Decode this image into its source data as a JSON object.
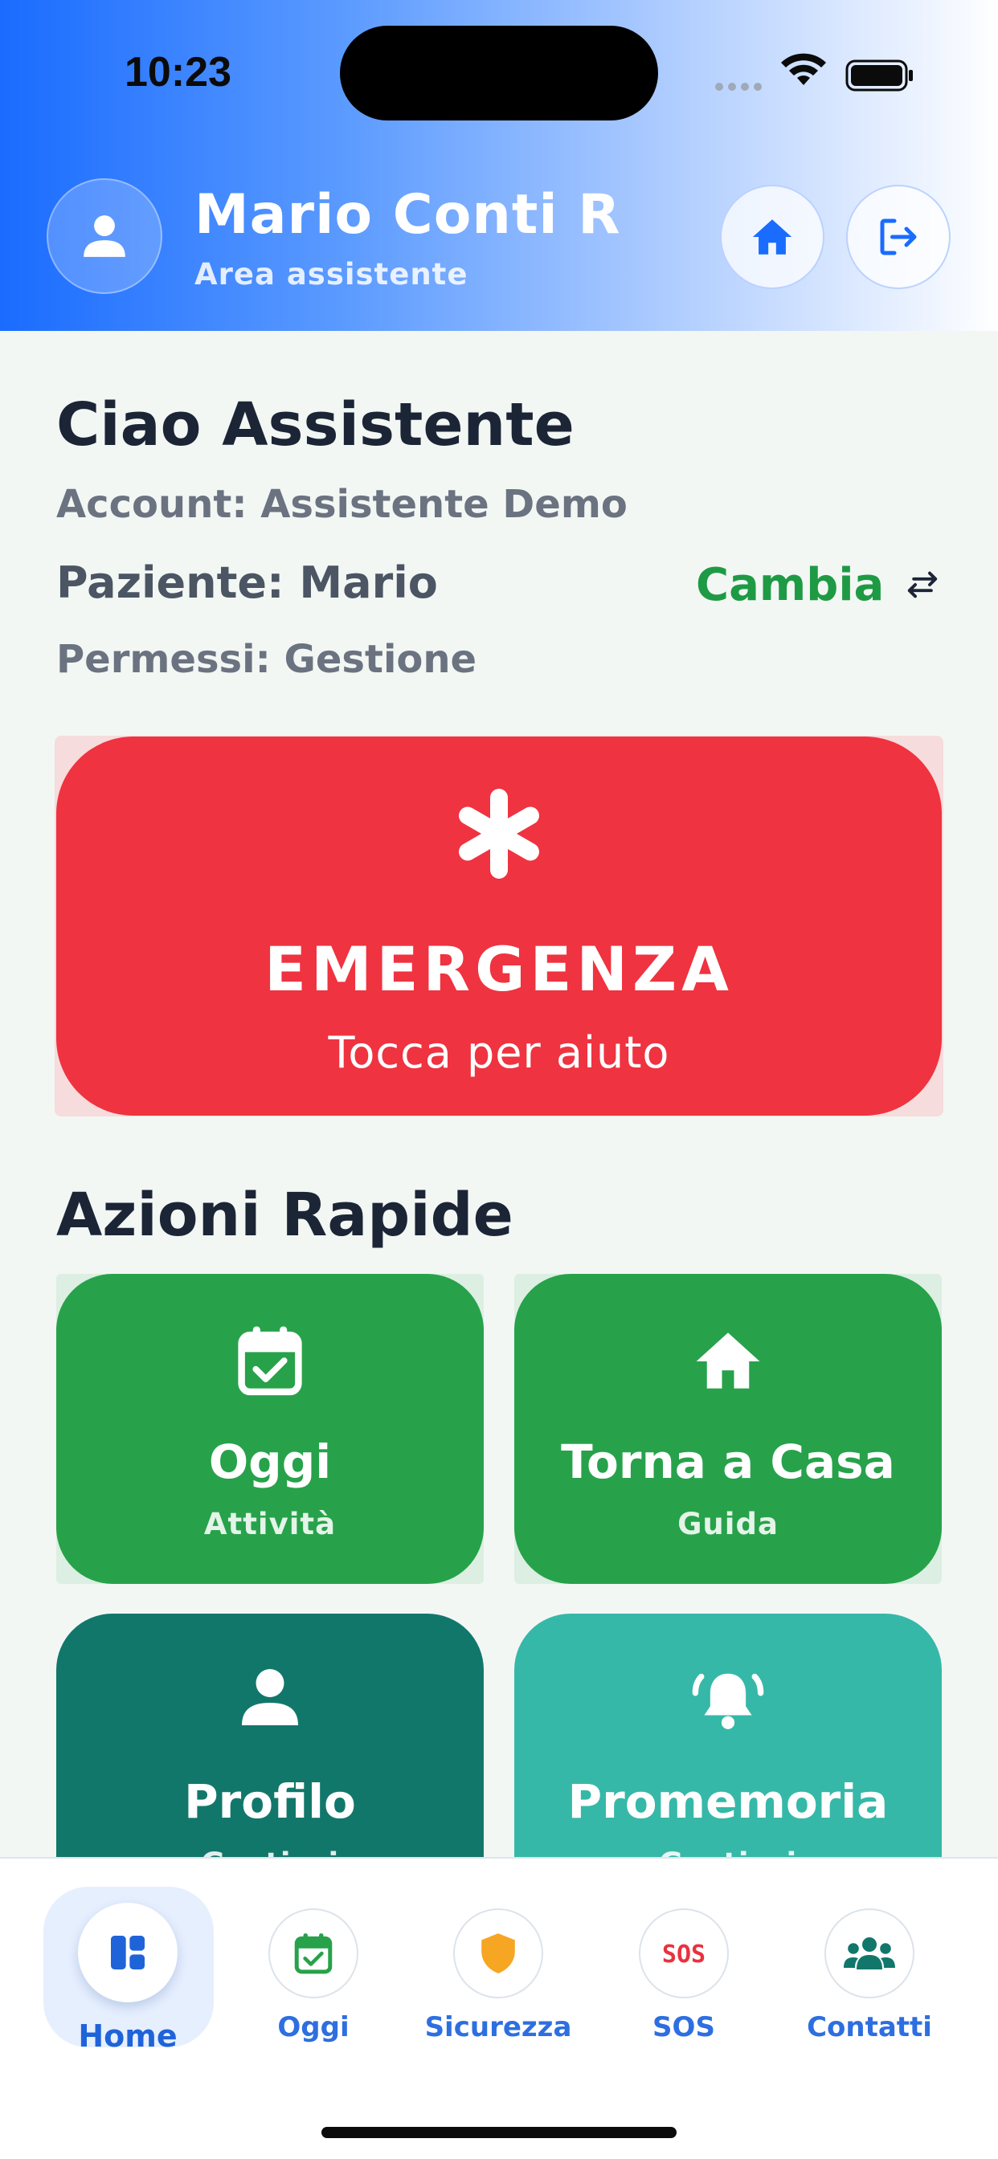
{
  "status_bar": {
    "time": "10:23"
  },
  "header": {
    "user_name": "Mario Conti R",
    "user_role": "Area assistente",
    "home_icon": "home-icon",
    "logout_icon": "logout-icon"
  },
  "greeting": {
    "title": "Ciao Assistente",
    "account": "Account: Assistente Demo",
    "patient": "Paziente: Mario",
    "change_label": "Cambia",
    "permissions": "Permessi: Gestione"
  },
  "emergency": {
    "icon": "asterisk-icon",
    "title": "EMERGENZA",
    "subtitle": "Tocca per aiuto",
    "color": "#ef3340"
  },
  "quick_actions": {
    "title": "Azioni Rapide",
    "tiles": [
      {
        "title": "Oggi",
        "subtitle": "Attività",
        "icon": "calendar-check-icon",
        "color": "#27a24a"
      },
      {
        "title": "Torna a Casa",
        "subtitle": "Guida",
        "icon": "home-icon",
        "color": "#27a24a"
      },
      {
        "title": "Profilo",
        "subtitle": "Gestisci",
        "icon": "user-icon",
        "color": "#12776b"
      },
      {
        "title": "Promemoria",
        "subtitle": "Gestisci",
        "icon": "bell-ring-icon",
        "color": "#36b8a8"
      }
    ]
  },
  "bottom_nav": {
    "items": [
      {
        "label": "Home",
        "icon": "dashboard-icon",
        "active": true
      },
      {
        "label": "Oggi",
        "icon": "calendar-check-icon",
        "active": false
      },
      {
        "label": "Sicurezza",
        "icon": "shield-icon",
        "active": false
      },
      {
        "label": "SOS",
        "icon": "sos-icon",
        "active": false
      },
      {
        "label": "Contatti",
        "icon": "contacts-icon",
        "active": false
      }
    ]
  },
  "colors": {
    "primary": "#1a6cff",
    "success": "#27a24a",
    "danger": "#ef3340",
    "nav_label": "#2d6fe0"
  }
}
